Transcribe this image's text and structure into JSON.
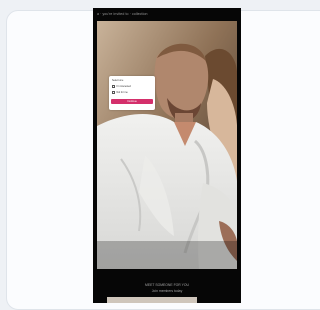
{
  "ad": {
    "top_text": "a · you're invited to · collection",
    "popup": {
      "title": "Select one",
      "option_1": "I'm interested",
      "option_2": "Not for me",
      "button_label": "Continue"
    },
    "caption_line_1": "MEET SOMEONE FOR YOU",
    "caption_line_2": "Join members today"
  },
  "colors": {
    "page_bg": "#eef1f5",
    "card_bg": "#fbfcfe",
    "ad_bg": "#060606",
    "popup_button": "#d42f6b"
  }
}
